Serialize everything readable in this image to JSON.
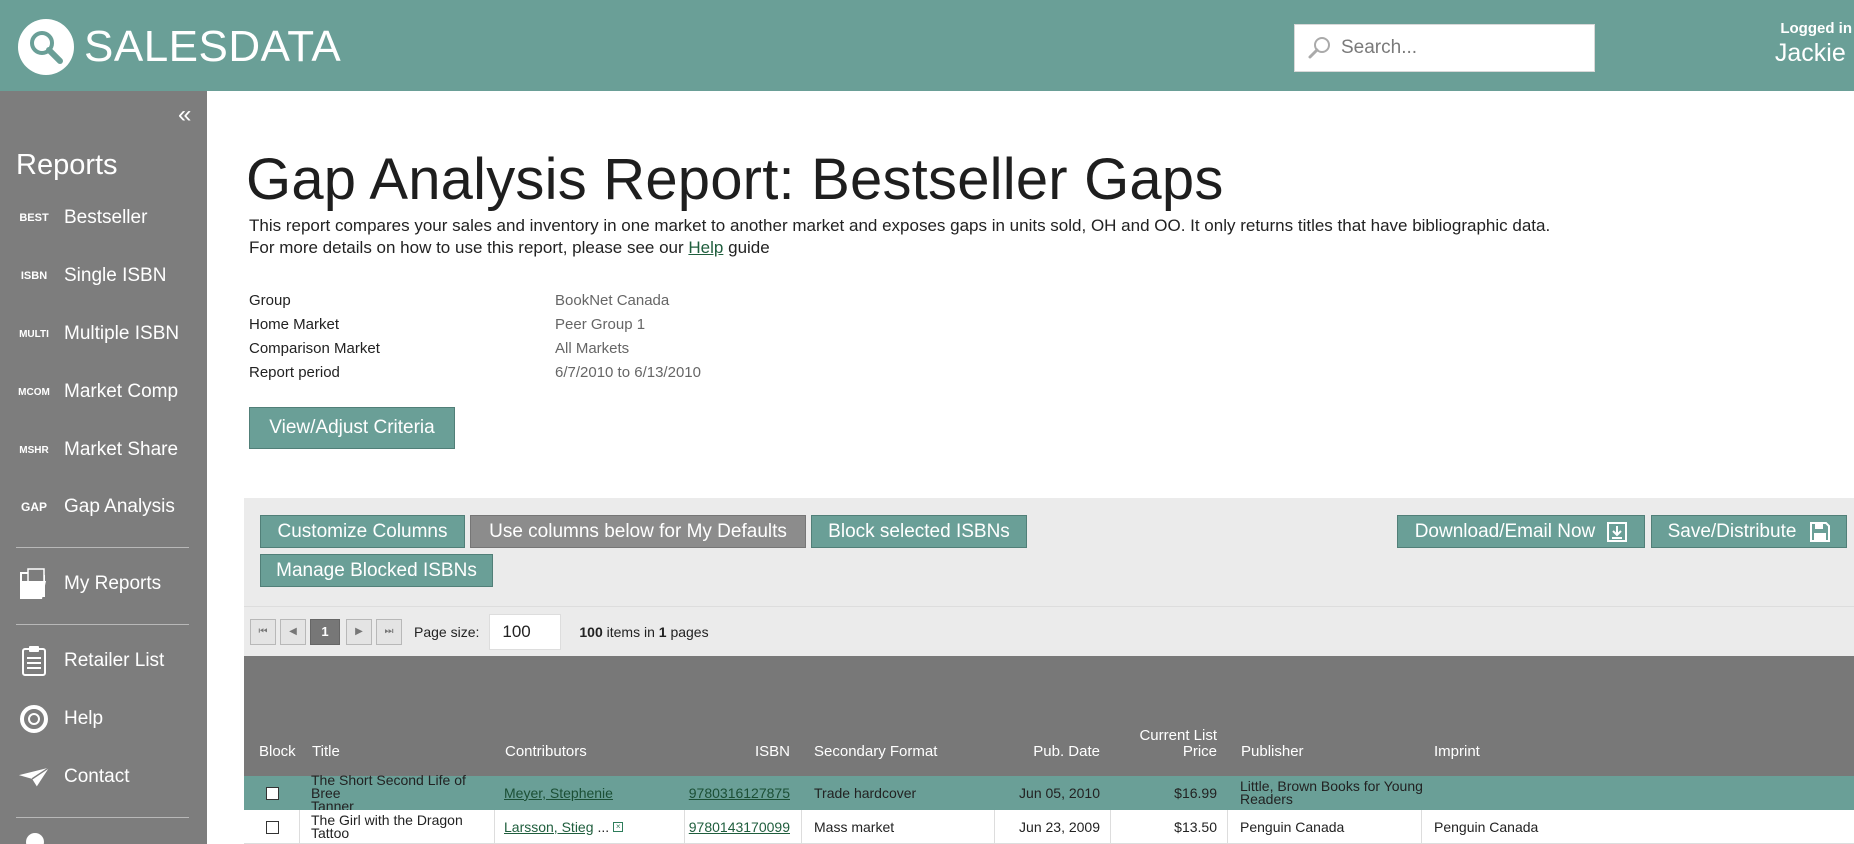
{
  "header": {
    "brand": "SALESDATA",
    "search_placeholder": "Search...",
    "logged_in_label": "Logged in",
    "user_name": "Jackie F"
  },
  "sidebar": {
    "heading": "Reports",
    "items": [
      {
        "icon": "BEST",
        "label": "Bestseller"
      },
      {
        "icon": "ISBN",
        "label": "Single ISBN"
      },
      {
        "icon": "MULTI",
        "label": "Multiple ISBN"
      },
      {
        "icon": "MCOM",
        "label": "Market Comp"
      },
      {
        "icon": "MSHR",
        "label": "Market Share"
      },
      {
        "icon": "GAP",
        "label": "Gap Analysis"
      }
    ],
    "my_reports": "My Reports",
    "retailer_list": "Retailer List",
    "help": "Help",
    "contact": "Contact"
  },
  "report": {
    "title": "Gap Analysis Report: Bestseller Gaps",
    "desc_line1": "This report compares your sales and inventory in one market to another market and exposes gaps in units sold, OH and OO. It only returns titles that have bibliographic data.",
    "desc_line2_prefix": "For more details on how to use this report, please see our",
    "desc_help_link": "Help",
    "desc_line2_suffix": "guide",
    "criteria": [
      {
        "label": "Group",
        "value": "BookNet Canada"
      },
      {
        "label": "Home Market",
        "value": "Peer Group 1"
      },
      {
        "label": "Comparison Market",
        "value": "All Markets"
      },
      {
        "label": "Report period",
        "value": "6/7/2010 to 6/13/2010"
      }
    ],
    "adjust_button": "View/Adjust Criteria"
  },
  "toolbar": {
    "customize": "Customize Columns",
    "defaults": "Use columns below for My Defaults",
    "block": "Block selected ISBNs",
    "manage": "Manage Blocked ISBNs",
    "download": "Download/Email Now",
    "save": "Save/Distribute"
  },
  "pager": {
    "current_page": "1",
    "page_size_label": "Page size:",
    "page_size": "100",
    "items_count": "100",
    "items_text": "items in",
    "pages_count": "1",
    "pages_text": "pages"
  },
  "table": {
    "headers": {
      "block": "Block",
      "title": "Title",
      "contributors": "Contributors",
      "isbn": "ISBN",
      "format": "Secondary Format",
      "pubdate": "Pub. Date",
      "price_l1": "Current List",
      "price_l2": "Price",
      "publisher": "Publisher",
      "imprint": "Imprint"
    },
    "rows": [
      {
        "title_l1": "The Short Second Life of Bree",
        "title_l2": "Tanner",
        "contributor": "Meyer, Stephenie",
        "isbn": "9780316127875",
        "format": "Trade hardcover",
        "pubdate": "Jun 05, 2010",
        "price": "$16.99",
        "publisher_l1": "Little, Brown Books for Young",
        "publisher_l2": "Readers",
        "imprint": ""
      },
      {
        "title_l1": "The Girl with the Dragon Tattoo",
        "title_l2": "",
        "contributor": "Larsson, Stieg",
        "contributor_more": "...",
        "isbn": "9780143170099",
        "format": "Mass market",
        "pubdate": "Jun 23, 2009",
        "price": "$13.50",
        "publisher_l1": "Penguin Canada",
        "publisher_l2": "",
        "imprint": "Penguin Canada"
      }
    ]
  }
}
